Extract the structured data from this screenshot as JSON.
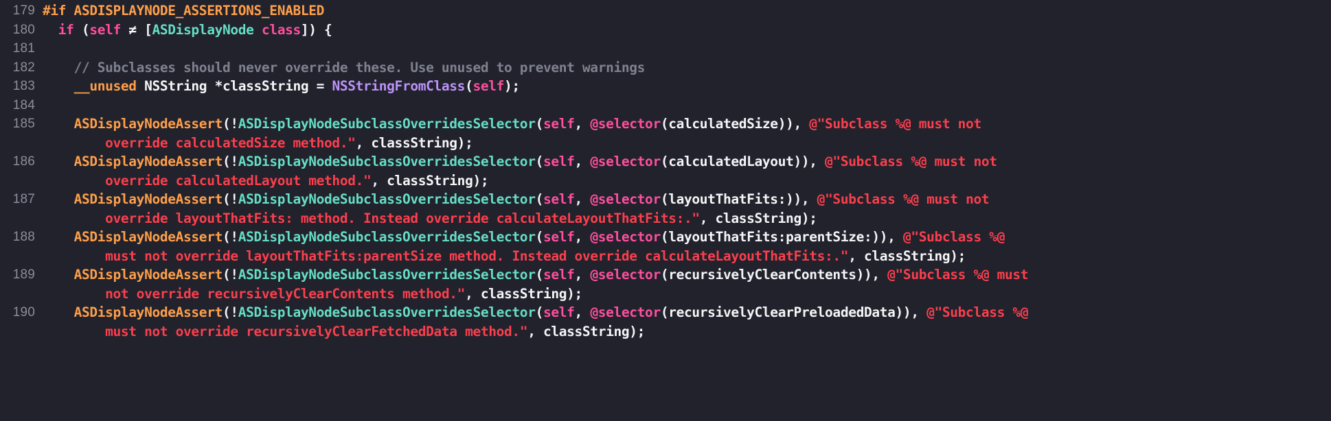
{
  "editor": {
    "theme_name": "dark-dracula-like",
    "background_color": "#21222c",
    "gutter_color": "#8b8e99",
    "colors": {
      "plain": "#f6f6f8",
      "keyword": "#ff4f9e",
      "type": "#66dec4",
      "comment": "#7f838f",
      "string": "#fc3f4d",
      "function": "#bd93f9",
      "macro": "#ff9f4a"
    },
    "language": "Objective-C",
    "first_line_number": 179,
    "last_line_number": 190
  },
  "gutter": {
    "numbers": [
      "179",
      "180",
      "181",
      "182",
      "183",
      "184",
      "185",
      "186",
      "187",
      "188",
      "189",
      "190"
    ]
  },
  "lines": [
    {
      "number": "179",
      "wrapped_rows": 1,
      "text": "#if ASDISPLAYNODE_ASSERTIONS_ENABLED",
      "tokens": [
        {
          "text": "#if ASDISPLAYNODE_ASSERTIONS_ENABLED",
          "kind": "macro"
        }
      ]
    },
    {
      "number": "180",
      "wrapped_rows": 1,
      "text": "  if (self ≠ [ASDisplayNode class]) {",
      "tokens": [
        {
          "text": "  ",
          "kind": "plain"
        },
        {
          "text": "if",
          "kind": "keyword"
        },
        {
          "text": " (",
          "kind": "plain"
        },
        {
          "text": "self",
          "kind": "keyword"
        },
        {
          "text": " ≠ [",
          "kind": "plain"
        },
        {
          "text": "ASDisplayNode",
          "kind": "type"
        },
        {
          "text": " ",
          "kind": "plain"
        },
        {
          "text": "class",
          "kind": "keyword"
        },
        {
          "text": "]) {",
          "kind": "plain"
        }
      ]
    },
    {
      "number": "181",
      "wrapped_rows": 1,
      "text": "",
      "tokens": []
    },
    {
      "number": "182",
      "wrapped_rows": 1,
      "text": "    // Subclasses should never override these. Use unused to prevent warnings",
      "tokens": [
        {
          "text": "    ",
          "kind": "plain"
        },
        {
          "text": "// Subclasses should never override these. Use unused to prevent warnings",
          "kind": "comment"
        }
      ]
    },
    {
      "number": "183",
      "wrapped_rows": 1,
      "text": "    __unused NSString *classString = NSStringFromClass(self);",
      "tokens": [
        {
          "text": "    ",
          "kind": "plain"
        },
        {
          "text": "__unused",
          "kind": "macro"
        },
        {
          "text": " NSString *classString = ",
          "kind": "plain"
        },
        {
          "text": "NSStringFromClass",
          "kind": "function"
        },
        {
          "text": "(",
          "kind": "plain"
        },
        {
          "text": "self",
          "kind": "keyword"
        },
        {
          "text": ");",
          "kind": "plain"
        }
      ]
    },
    {
      "number": "184",
      "wrapped_rows": 1,
      "text": "",
      "tokens": []
    },
    {
      "number": "185",
      "wrapped_rows": 2,
      "text": "    ASDisplayNodeAssert(!ASDisplayNodeSubclassOverridesSelector(self, @selector(calculatedSize)), @\"Subclass %@ must not override calculatedSize method.\", classString);",
      "rows": [
        [
          {
            "text": "    ",
            "kind": "plain"
          },
          {
            "text": "ASDisplayNodeAssert",
            "kind": "macro"
          },
          {
            "text": "(!",
            "kind": "plain"
          },
          {
            "text": "ASDisplayNodeSubclassOverridesSelector",
            "kind": "type"
          },
          {
            "text": "(",
            "kind": "plain"
          },
          {
            "text": "self",
            "kind": "keyword"
          },
          {
            "text": ", ",
            "kind": "plain"
          },
          {
            "text": "@selector",
            "kind": "keyword"
          },
          {
            "text": "(calculatedSize)), ",
            "kind": "plain"
          },
          {
            "text": "@\"Subclass %@ must not",
            "kind": "string"
          }
        ],
        [
          {
            "text": "        ",
            "kind": "plain"
          },
          {
            "text": "override calculatedSize method.\"",
            "kind": "string"
          },
          {
            "text": ", classString);",
            "kind": "plain"
          }
        ]
      ]
    },
    {
      "number": "186",
      "wrapped_rows": 2,
      "text": "    ASDisplayNodeAssert(!ASDisplayNodeSubclassOverridesSelector(self, @selector(calculatedLayout)), @\"Subclass %@ must not override calculatedLayout method.\", classString);",
      "rows": [
        [
          {
            "text": "    ",
            "kind": "plain"
          },
          {
            "text": "ASDisplayNodeAssert",
            "kind": "macro"
          },
          {
            "text": "(!",
            "kind": "plain"
          },
          {
            "text": "ASDisplayNodeSubclassOverridesSelector",
            "kind": "type"
          },
          {
            "text": "(",
            "kind": "plain"
          },
          {
            "text": "self",
            "kind": "keyword"
          },
          {
            "text": ", ",
            "kind": "plain"
          },
          {
            "text": "@selector",
            "kind": "keyword"
          },
          {
            "text": "(calculatedLayout)), ",
            "kind": "plain"
          },
          {
            "text": "@\"Subclass %@ must not",
            "kind": "string"
          }
        ],
        [
          {
            "text": "        ",
            "kind": "plain"
          },
          {
            "text": "override calculatedLayout method.\"",
            "kind": "string"
          },
          {
            "text": ", classString);",
            "kind": "plain"
          }
        ]
      ]
    },
    {
      "number": "187",
      "wrapped_rows": 2,
      "text": "    ASDisplayNodeAssert(!ASDisplayNodeSubclassOverridesSelector(self, @selector(layoutThatFits:)), @\"Subclass %@ must not override layoutThatFits: method. Instead override calculateLayoutThatFits:.\", classString);",
      "rows": [
        [
          {
            "text": "    ",
            "kind": "plain"
          },
          {
            "text": "ASDisplayNodeAssert",
            "kind": "macro"
          },
          {
            "text": "(!",
            "kind": "plain"
          },
          {
            "text": "ASDisplayNodeSubclassOverridesSelector",
            "kind": "type"
          },
          {
            "text": "(",
            "kind": "plain"
          },
          {
            "text": "self",
            "kind": "keyword"
          },
          {
            "text": ", ",
            "kind": "plain"
          },
          {
            "text": "@selector",
            "kind": "keyword"
          },
          {
            "text": "(layoutThatFits:)), ",
            "kind": "plain"
          },
          {
            "text": "@\"Subclass %@ must not",
            "kind": "string"
          }
        ],
        [
          {
            "text": "        ",
            "kind": "plain"
          },
          {
            "text": "override layoutThatFits: method. Instead override calculateLayoutThatFits:.\"",
            "kind": "string"
          },
          {
            "text": ", classString);",
            "kind": "plain"
          }
        ]
      ]
    },
    {
      "number": "188",
      "wrapped_rows": 2,
      "text": "    ASDisplayNodeAssert(!ASDisplayNodeSubclassOverridesSelector(self, @selector(layoutThatFits:parentSize:)), @\"Subclass %@ must not override layoutThatFits:parentSize method. Instead override calculateLayoutThatFits:.\", classString);",
      "rows": [
        [
          {
            "text": "    ",
            "kind": "plain"
          },
          {
            "text": "ASDisplayNodeAssert",
            "kind": "macro"
          },
          {
            "text": "(!",
            "kind": "plain"
          },
          {
            "text": "ASDisplayNodeSubclassOverridesSelector",
            "kind": "type"
          },
          {
            "text": "(",
            "kind": "plain"
          },
          {
            "text": "self",
            "kind": "keyword"
          },
          {
            "text": ", ",
            "kind": "plain"
          },
          {
            "text": "@selector",
            "kind": "keyword"
          },
          {
            "text": "(layoutThatFits:parentSize:)), ",
            "kind": "plain"
          },
          {
            "text": "@\"Subclass %@",
            "kind": "string"
          }
        ],
        [
          {
            "text": "        ",
            "kind": "plain"
          },
          {
            "text": "must not override layoutThatFits:parentSize method. Instead override calculateLayoutThatFits:.\"",
            "kind": "string"
          },
          {
            "text": ", classString);",
            "kind": "plain"
          }
        ]
      ]
    },
    {
      "number": "189",
      "wrapped_rows": 2,
      "text": "    ASDisplayNodeAssert(!ASDisplayNodeSubclassOverridesSelector(self, @selector(recursivelyClearContents)), @\"Subclass %@ must not override recursivelyClearContents method.\", classString);",
      "rows": [
        [
          {
            "text": "    ",
            "kind": "plain"
          },
          {
            "text": "ASDisplayNodeAssert",
            "kind": "macro"
          },
          {
            "text": "(!",
            "kind": "plain"
          },
          {
            "text": "ASDisplayNodeSubclassOverridesSelector",
            "kind": "type"
          },
          {
            "text": "(",
            "kind": "plain"
          },
          {
            "text": "self",
            "kind": "keyword"
          },
          {
            "text": ", ",
            "kind": "plain"
          },
          {
            "text": "@selector",
            "kind": "keyword"
          },
          {
            "text": "(recursivelyClearContents)), ",
            "kind": "plain"
          },
          {
            "text": "@\"Subclass %@ must",
            "kind": "string"
          }
        ],
        [
          {
            "text": "        ",
            "kind": "plain"
          },
          {
            "text": "not override recursivelyClearContents method.\"",
            "kind": "string"
          },
          {
            "text": ", classString);",
            "kind": "plain"
          }
        ]
      ]
    },
    {
      "number": "190",
      "wrapped_rows": 2,
      "text": "    ASDisplayNodeAssert(!ASDisplayNodeSubclassOverridesSelector(self, @selector(recursivelyClearPreloadedData)), @\"Subclass %@ must not override recursivelyClearFetchedData method.\", classString);",
      "rows": [
        [
          {
            "text": "    ",
            "kind": "plain"
          },
          {
            "text": "ASDisplayNodeAssert",
            "kind": "macro"
          },
          {
            "text": "(!",
            "kind": "plain"
          },
          {
            "text": "ASDisplayNodeSubclassOverridesSelector",
            "kind": "type"
          },
          {
            "text": "(",
            "kind": "plain"
          },
          {
            "text": "self",
            "kind": "keyword"
          },
          {
            "text": ", ",
            "kind": "plain"
          },
          {
            "text": "@selector",
            "kind": "keyword"
          },
          {
            "text": "(recursivelyClearPreloadedData)), ",
            "kind": "plain"
          },
          {
            "text": "@\"Subclass %@",
            "kind": "string"
          }
        ],
        [
          {
            "text": "        ",
            "kind": "plain"
          },
          {
            "text": "must not override recursivelyClearFetchedData method.\"",
            "kind": "string"
          },
          {
            "text": ", classString);",
            "kind": "plain"
          }
        ]
      ]
    }
  ]
}
